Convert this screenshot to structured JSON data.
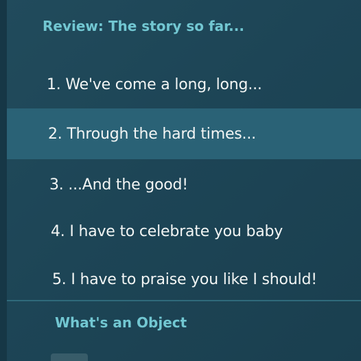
{
  "review_section": {
    "title": "Review: The story so far...",
    "items": [
      {
        "label": "1. We've come a long, long..."
      },
      {
        "label": "2. Through the hard times..."
      },
      {
        "label": "3. ...And the good!"
      },
      {
        "label": "4. I have to celebrate you baby"
      },
      {
        "label": "5. I have to praise you like I should!"
      }
    ]
  },
  "next_section": {
    "title": "What's an Object"
  },
  "colors": {
    "background": "#1d4556",
    "highlight": "#2a6276",
    "title_accent": "#72c7d2",
    "text": "#f2f5f4"
  }
}
